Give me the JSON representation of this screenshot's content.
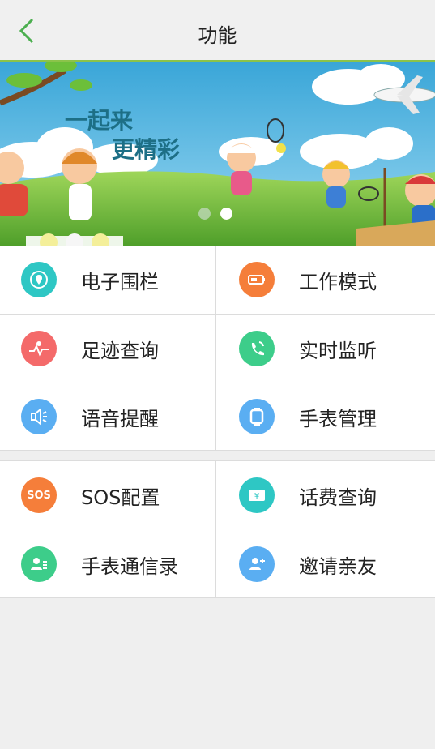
{
  "header": {
    "title": "功能",
    "back_icon": "chevron-left-icon"
  },
  "banner": {
    "line1": "一起来",
    "line2": "更精彩"
  },
  "colors": {
    "accent": "#8bc34a",
    "teal": "#2ec7c4",
    "orange": "#f57e3a",
    "red": "#f46a6a",
    "green": "#3dcd8a",
    "blue": "#5aaef2"
  },
  "section1": [
    {
      "label": "电子围栏",
      "icon": "location-pin-icon",
      "color": "#2ec7c4"
    },
    {
      "label": "工作模式",
      "icon": "battery-icon",
      "color": "#f57e3a"
    },
    {
      "label": "足迹查询",
      "icon": "route-icon",
      "color": "#f46a6a"
    },
    {
      "label": "实时监听",
      "icon": "phone-call-icon",
      "color": "#3dcd8a"
    },
    {
      "label": "语音提醒",
      "icon": "speaker-icon",
      "color": "#5aaef2"
    },
    {
      "label": "手表管理",
      "icon": "watch-icon",
      "color": "#5aaef2"
    }
  ],
  "section2": [
    {
      "label": "SOS配置",
      "icon": "sos-icon",
      "color": "#f57e3a",
      "badge": "SOS"
    },
    {
      "label": "话费查询",
      "icon": "bill-icon",
      "color": "#2ec7c4"
    },
    {
      "label": "手表通信录",
      "icon": "contacts-icon",
      "color": "#3dcd8a"
    },
    {
      "label": "邀请亲友",
      "icon": "add-user-icon",
      "color": "#5aaef2"
    }
  ]
}
